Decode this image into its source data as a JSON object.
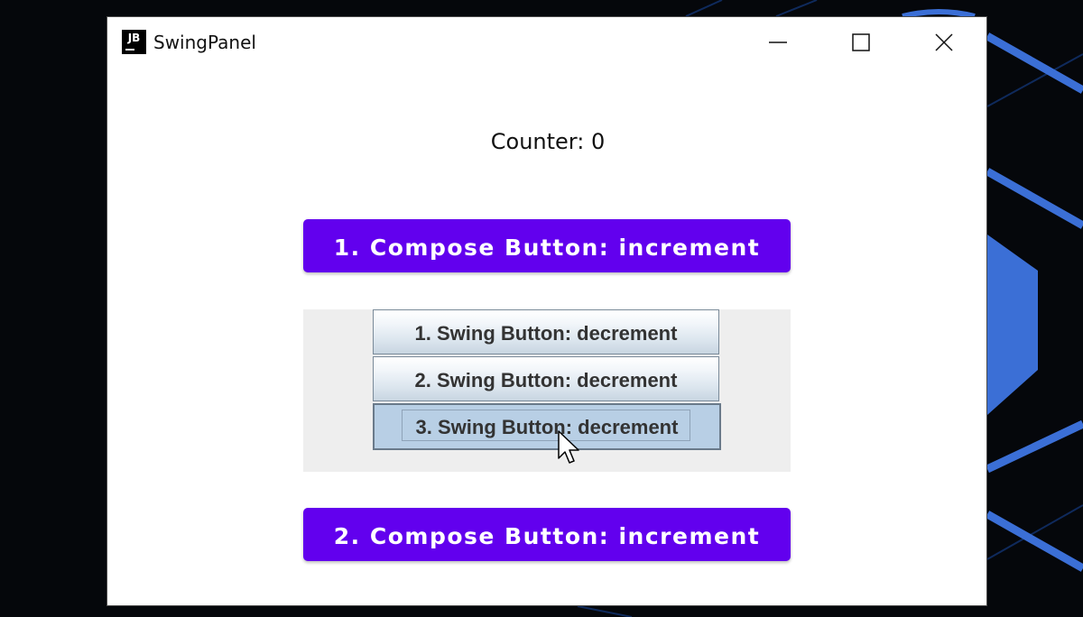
{
  "window": {
    "title": "SwingPanel",
    "logo_text": "JB",
    "controls": {
      "minimize": "minimize-icon",
      "maximize": "maximize-icon",
      "close": "close-icon"
    }
  },
  "counter": {
    "label": "Counter: 0"
  },
  "compose_buttons": [
    {
      "label": "1. Compose Button: increment"
    },
    {
      "label": "2. Compose Button: increment"
    }
  ],
  "swing_buttons": [
    {
      "label": "1. Swing Button: decrement"
    },
    {
      "label": "2. Swing Button: decrement"
    },
    {
      "label": "3. Swing Button: decrement",
      "state": "pressed"
    }
  ],
  "colors": {
    "compose_accent": "#6200ee",
    "swing_panel_bg": "#eeeeee",
    "desktop_accent": "#3b6fd6"
  }
}
